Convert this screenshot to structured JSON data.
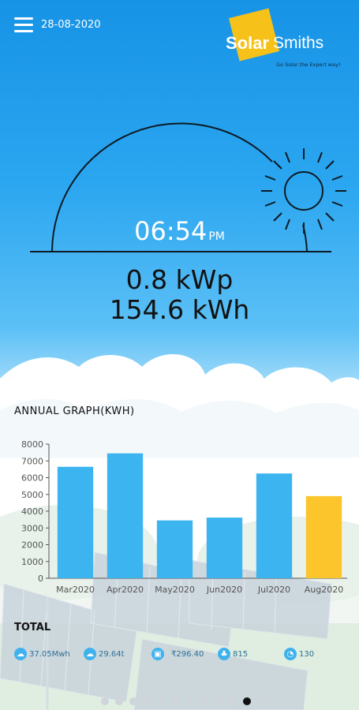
{
  "header": {
    "date": "28-08-2020",
    "logo": {
      "solar": "Solar",
      "smiths": "Smiths",
      "tagline": "Go Solar the Expert way!"
    }
  },
  "sun": {
    "time": "06:54",
    "ampm": "PM"
  },
  "power": {
    "kwp": "0.8 kWp",
    "kwh": "154.6 kWh"
  },
  "annual": {
    "title": "ANNUAL GRAPH(KWH)"
  },
  "chart_data": {
    "type": "bar",
    "title": "ANNUAL GRAPH(KWH)",
    "categories": [
      "Mar2020",
      "Apr2020",
      "May2020",
      "Jun2020",
      "Jul2020",
      "Aug2020"
    ],
    "values": [
      6650,
      7450,
      3450,
      3620,
      6250,
      4900
    ],
    "colors": [
      "#3cb4f0",
      "#3cb4f0",
      "#3cb4f0",
      "#3cb4f0",
      "#3cb4f0",
      "#fbc52b"
    ],
    "ylim": [
      0,
      8000
    ],
    "yticks": [
      0,
      1000,
      2000,
      3000,
      4000,
      5000,
      6000,
      7000,
      8000
    ],
    "grid": false
  },
  "total": {
    "title": "TOTAL",
    "stats": [
      {
        "icon": "energy-icon",
        "value": "37.05Mwh"
      },
      {
        "icon": "co2-cloud-icon",
        "value": "29.64t"
      },
      {
        "icon": "savings-icon",
        "value": "₹296.40"
      },
      {
        "icon": "tree-icon",
        "value": "815"
      },
      {
        "icon": "gauge-icon",
        "value": "130"
      }
    ]
  },
  "pagination": {
    "count": 12,
    "active": 10
  },
  "colors": {
    "sky": "#2ba6f0",
    "bar": "#3cb4f0",
    "highlight": "#fbc52b",
    "logo": "#f6c21a"
  }
}
